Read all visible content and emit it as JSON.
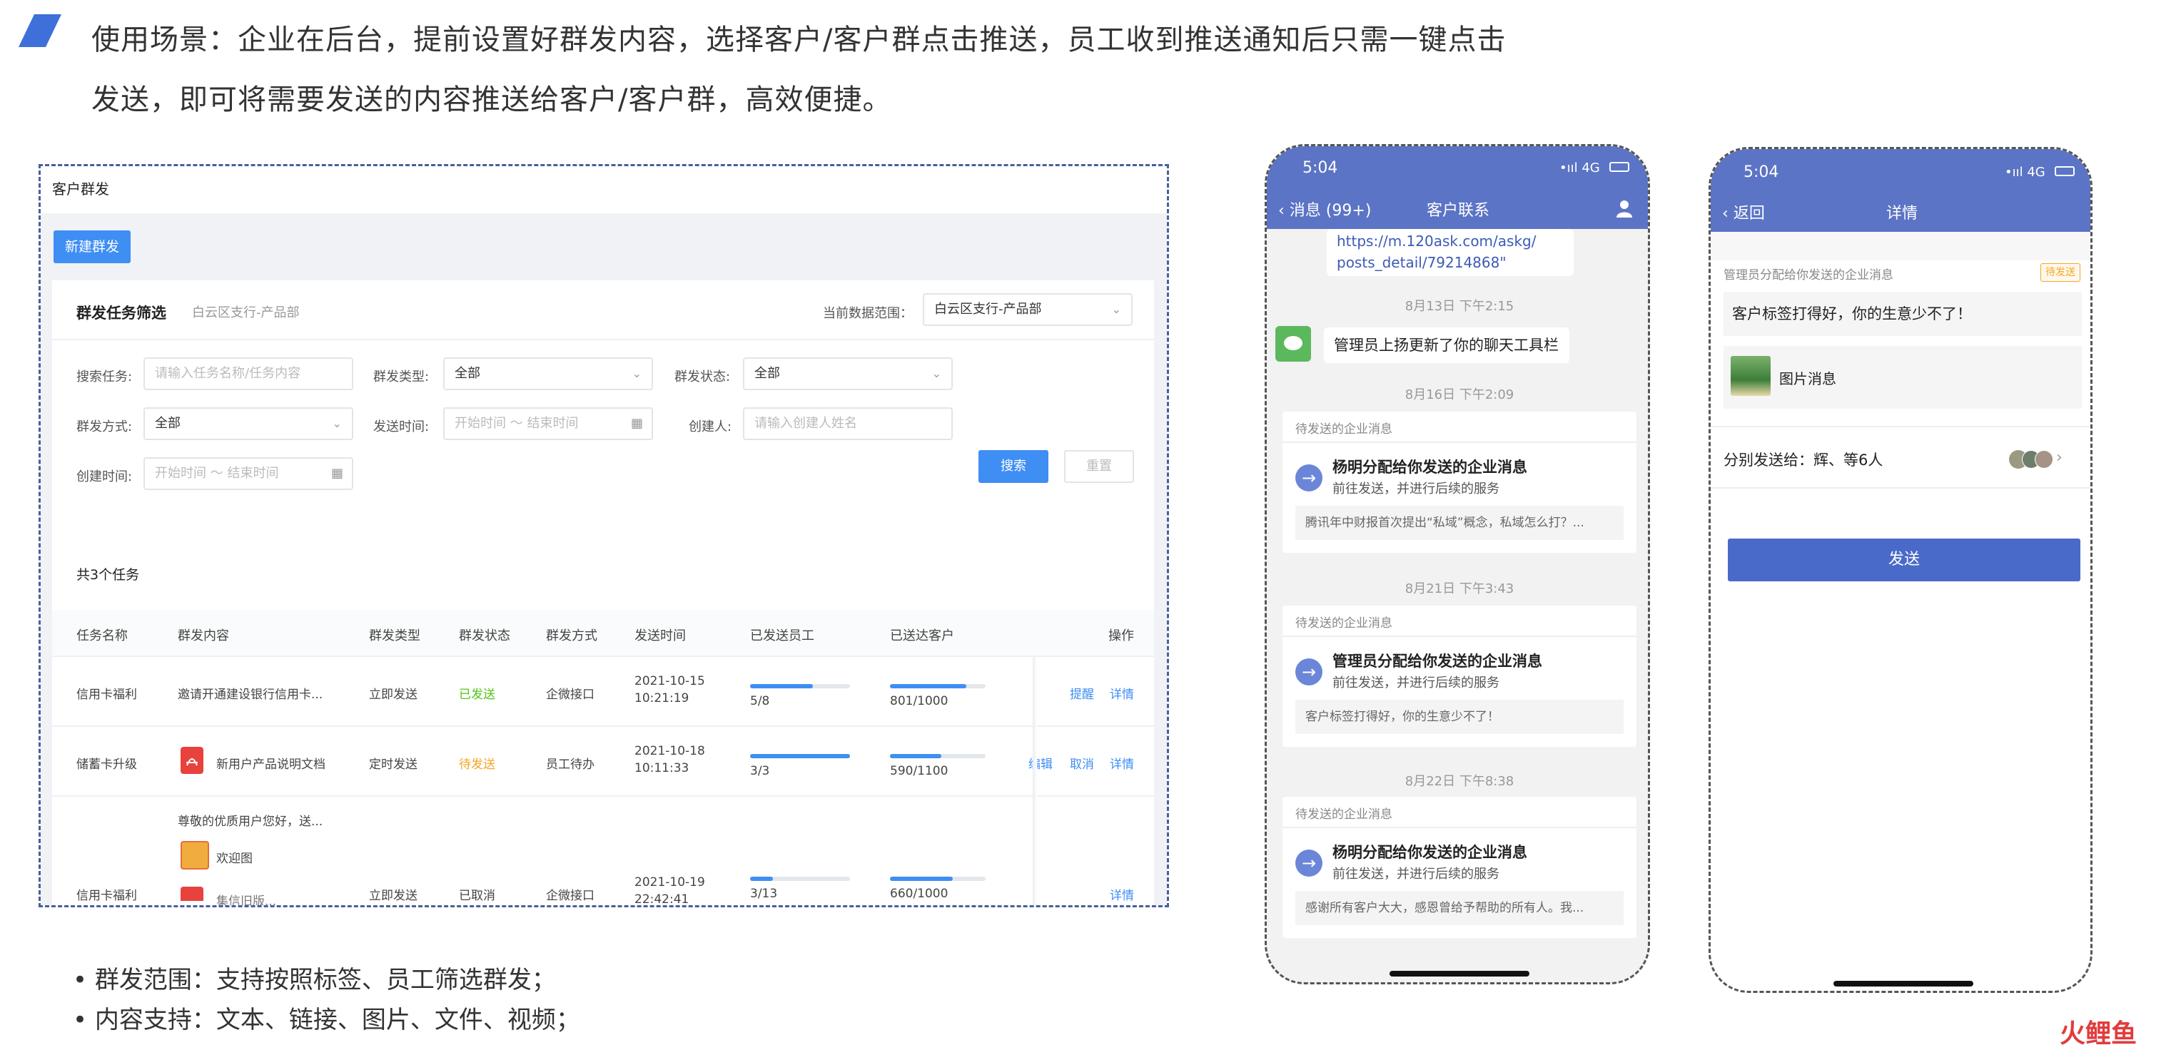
{
  "header": {
    "line1": "使用场景：企业在后台，提前设置好群发内容，选择客户/客户群点击推送，员工收到推送通知后只需一键点击",
    "line2": "发送，即可将需要发送的内容推送给客户/客户群，高效便捷。"
  },
  "admin": {
    "window_title": "客户群发",
    "new_button": "新建群发",
    "filter": {
      "title": "群发任务筛选",
      "subtitle": "白云区支行-产品部",
      "range_label": "当前数据范围：",
      "range_value": "白云区支行-产品部",
      "fields": {
        "task_label": "搜索任务:",
        "task_placeholder": "请输入任务名称/任务内容",
        "type_label": "群发类型:",
        "type_value": "全部",
        "status_label": "群发状态:",
        "status_value": "全部",
        "method_label": "群发方式:",
        "method_value": "全部",
        "send_time_label": "发送时间:",
        "send_time_placeholder": "开始时间 ～ 结束时间",
        "creator_label": "创建人:",
        "creator_placeholder": "请输入创建人姓名",
        "create_time_label": "创建时间:",
        "create_time_placeholder": "开始时间 ～ 结束时间"
      },
      "search_button": "搜索",
      "reset_button": "重置"
    },
    "table": {
      "count_text": "共3个任务",
      "headers": [
        "任务名称",
        "群发内容",
        "群发类型",
        "群发状态",
        "群发方式",
        "发送时间",
        "已发送员工",
        "已送达客户",
        "操作"
      ],
      "rows": [
        {
          "name": "信用卡福利",
          "content": "邀请开通建设银行信用卡...",
          "type": "立即发送",
          "status": "已发送",
          "method": "企微接口",
          "date": "2021-10-15",
          "time": "10:21:19",
          "staff": "5/8",
          "staff_pct": 0.625,
          "customers": "801/1000",
          "customers_pct": 0.8,
          "actions": [
            "提醒",
            "详情"
          ]
        },
        {
          "name": "储蓄卡升级",
          "content": "新用户产品说明文档",
          "type": "定时发送",
          "status": "待发送",
          "method": "员工待办",
          "date": "2021-10-18",
          "time": "10:11:33",
          "staff": "3/3",
          "staff_pct": 1.0,
          "customers": "590/1100",
          "customers_pct": 0.54,
          "actions": [
            "编辑",
            "取消",
            "详情"
          ]
        },
        {
          "name": "信用卡福利",
          "content": "尊敬的优质用户您好，送...",
          "content_extra": "欢迎图",
          "content_extra2": "集信旧版...",
          "type": "立即发送",
          "status": "已取消",
          "method": "企微接口",
          "date": "2021-10-19",
          "time": "22:42:41",
          "staff": "3/13",
          "staff_pct": 0.23,
          "customers": "660/1000",
          "customers_pct": 0.66,
          "actions": [
            "详情"
          ]
        }
      ]
    }
  },
  "bullets": [
    "• 群发范围：支持按照标签、员工筛选群发；",
    "• 内容支持：文本、链接、图片、文件、视频；"
  ],
  "phone1": {
    "time": "5:04",
    "signal": "•ııl 4G",
    "back": "消息 (99+)",
    "title": "客户联系",
    "link_line1": "https://m.120ask.com/askg/",
    "link_line2": "posts_detail/79214868\"",
    "t1": "8月13日 下午2:15",
    "sys_msg": "管理员上扬更新了你的聊天工具栏",
    "t2": "8月16日 下午2:09",
    "cards": [
      {
        "tag": "待发送的企业消息",
        "title": "杨明分配给你发送的企业消息",
        "sub": "前往发送，并进行后续的服务",
        "quote": "腾讯年中财报首次提出“私域”概念，私域怎么打？..."
      },
      {
        "tag": "待发送的企业消息",
        "title": "管理员分配给你发送的企业消息",
        "sub": "前往发送，并进行后续的服务",
        "quote": "客户标签打得好，你的生意少不了！"
      },
      {
        "tag": "待发送的企业消息",
        "title": "杨明分配给你发送的企业消息",
        "sub": "前往发送，并进行后续的服务",
        "quote": "感谢所有客户大大，感恩曾给予帮助的所有人。我..."
      }
    ],
    "t3": "8月21日 下午3:43",
    "t4": "8月22日 下午8:38"
  },
  "phone2": {
    "time": "5:04",
    "signal": "•ııl 4G",
    "back": "返回",
    "title": "详情",
    "tag": "管理员分配给你发送的企业消息",
    "badge": "待发送",
    "text_msg": "客户标签打得好，你的生意少不了！",
    "image_msg": "图片消息",
    "send_to": "分别发送给：辉、等6人",
    "send_button": "发送"
  },
  "watermark": "火鲤鱼"
}
